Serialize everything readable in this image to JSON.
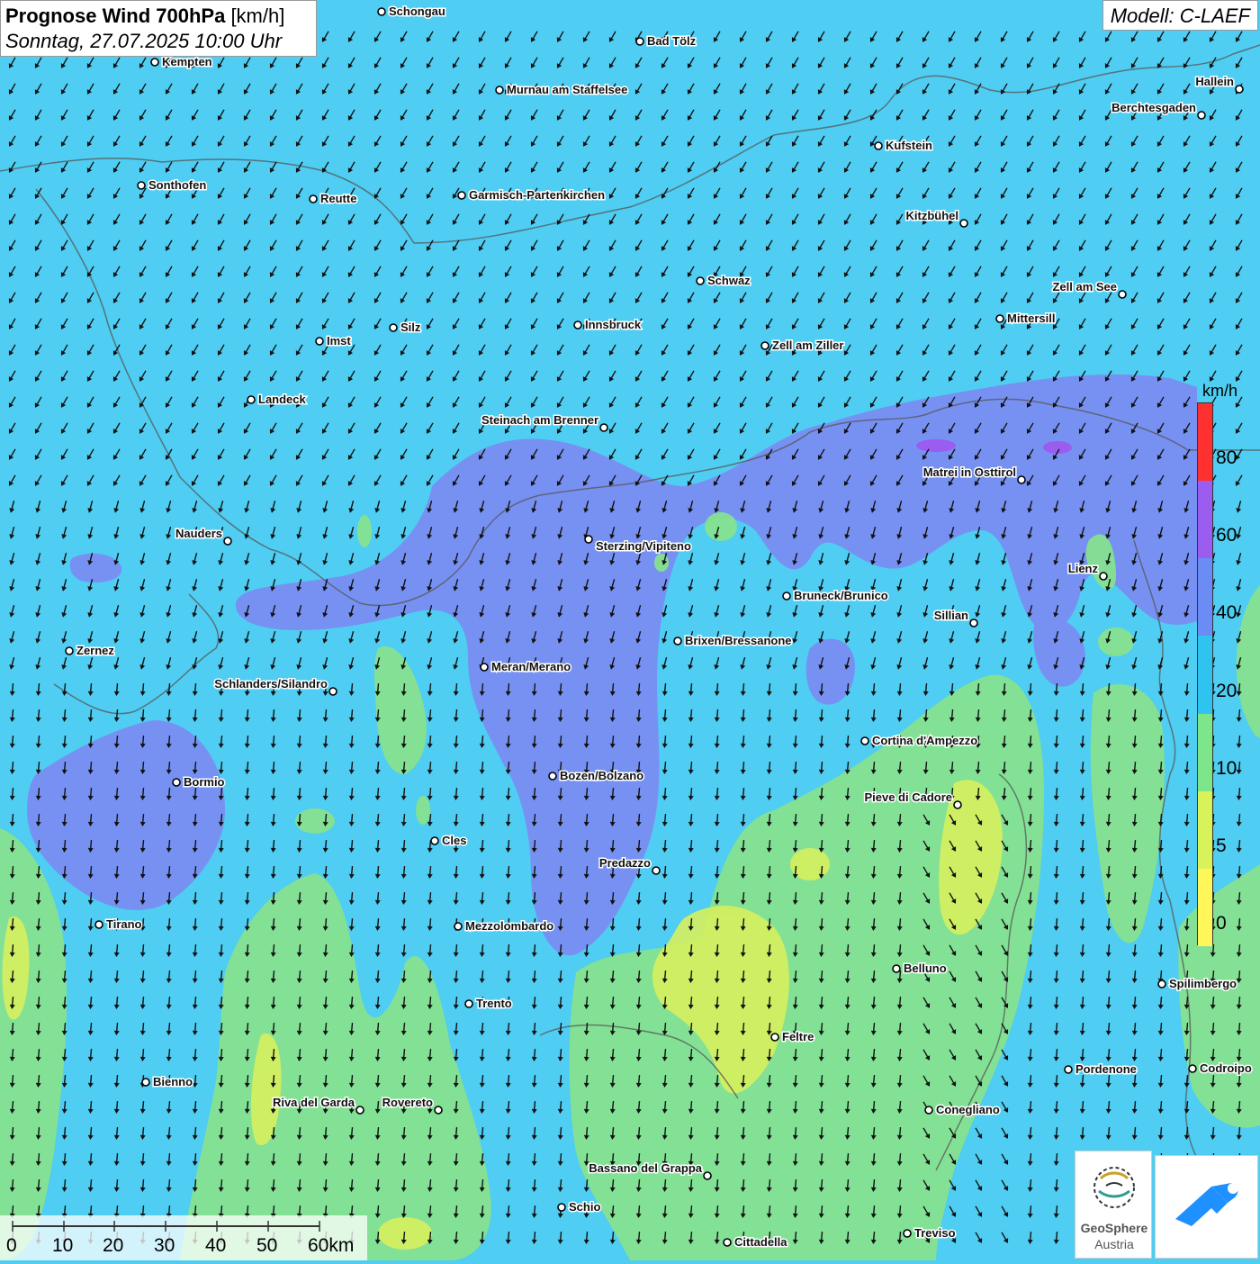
{
  "title": {
    "main": "Prognose Wind 700hPa",
    "unit": "[km/h]",
    "datetime": "Sonntag, 27.07.2025 10:00 Uhr"
  },
  "model": "Modell: C-LAEF",
  "legend": {
    "unit": "km/h",
    "labels": [
      "80",
      "60",
      "40",
      "20",
      "10",
      "5",
      "0"
    ],
    "colors": [
      "#ff3030",
      "#9b5cf0",
      "#6b8cf5",
      "#2fc3ef",
      "#7ee68a",
      "#d8f25a",
      "#fff75a"
    ]
  },
  "scale": {
    "labels": [
      "0",
      "10",
      "20",
      "30",
      "40",
      "50",
      "60km"
    ]
  },
  "logo": {
    "name_line1": "GeoSphere",
    "name_line2": "Austria"
  },
  "cities": [
    "Schongau",
    "Bad Tölz",
    "Kempten",
    "Murnau am Staffelsee",
    "Hallein",
    "Berchtesgaden",
    "Kufstein",
    "Sonthofen",
    "Reutte",
    "Garmisch-Partenkirchen",
    "Kitzbühel",
    "Schwaz",
    "Zell am See",
    "Mittersill",
    "Innsbruck",
    "Silz",
    "Imst",
    "Zell am Ziller",
    "Landeck",
    "Steinach am Brenner",
    "Matrei in Osttirol",
    "Nauders",
    "Sterzing/Vipiteno",
    "Lienz",
    "Bruneck/Brunico",
    "Sillian",
    "Zernez",
    "Brixen/Bressanone",
    "Meran/Merano",
    "Schlanders/Silandro",
    "Cortina d'Ampezzo",
    "Bozen/Bolzano",
    "Bormio",
    "Pieve di Cadore",
    "Cles",
    "Predazzo",
    "Tirano",
    "Mezzolombardo",
    "Belluno",
    "Spilimbergo",
    "Trento",
    "Feltre",
    "Bienno",
    "Pordenone",
    "Codroipo",
    "Riva del Garda",
    "Rovereto",
    "Conegliano",
    "Bassano del Grappa",
    "Schio",
    "Treviso",
    "Cittadella"
  ]
}
